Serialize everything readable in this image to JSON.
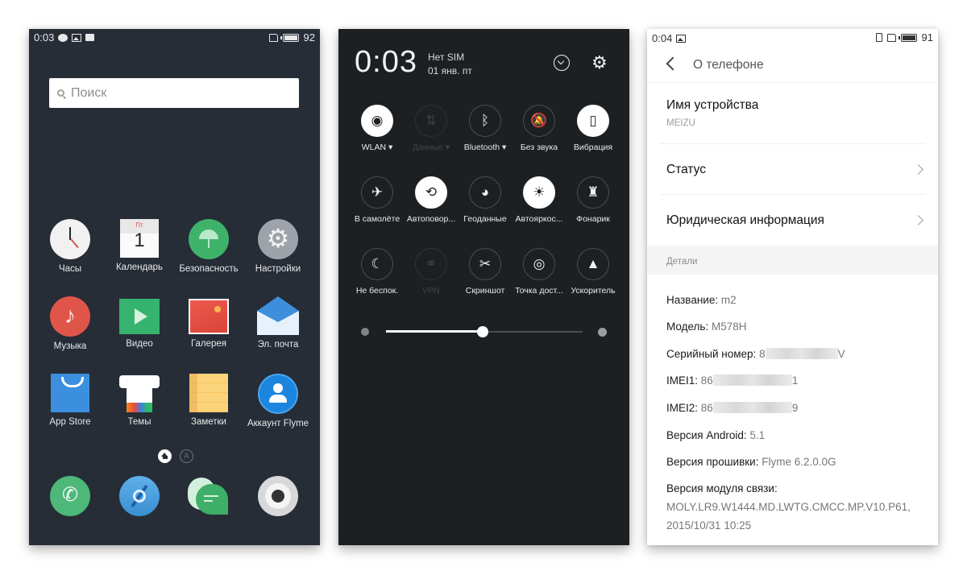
{
  "home_screen": {
    "status_bar": {
      "time": "0:03",
      "battery": "92",
      "left_icons": [
        "message-icon",
        "image-icon",
        "notification-card-icon"
      ],
      "right_icons": [
        "sim-icon",
        "battery-icon"
      ]
    },
    "search": {
      "placeholder": "Поиск"
    },
    "apps": [
      {
        "label": "Часы",
        "icon": "clock-icon"
      },
      {
        "label": "Календарь",
        "icon": "calendar-icon",
        "calendar_day": "Пт",
        "calendar_date": "1"
      },
      {
        "label": "Безопасность",
        "icon": "security-icon"
      },
      {
        "label": "Настройки",
        "icon": "settings-icon"
      },
      {
        "label": "Музыка",
        "icon": "music-icon"
      },
      {
        "label": "Видео",
        "icon": "video-icon"
      },
      {
        "label": "Галерея",
        "icon": "gallery-icon"
      },
      {
        "label": "Эл. почта",
        "icon": "email-icon"
      },
      {
        "label": "App Store",
        "icon": "app-store-icon"
      },
      {
        "label": "Темы",
        "icon": "themes-icon"
      },
      {
        "label": "Заметки",
        "icon": "notes-icon"
      },
      {
        "label": "Аккаунт Flyme",
        "icon": "flyme-account-icon"
      }
    ],
    "page_indicator": {
      "home": "home-icon",
      "app_page_letter": "A"
    },
    "dock": [
      {
        "icon": "phone-icon"
      },
      {
        "icon": "browser-icon"
      },
      {
        "icon": "messages-icon"
      },
      {
        "icon": "camera-icon"
      }
    ],
    "colors": {
      "background": "#262d37"
    }
  },
  "quick_settings": {
    "time": "0:03",
    "sim_status": "Нет SIM",
    "date": "01 янв. пт",
    "tiles": [
      {
        "label": "WLAN ▾",
        "icon": "wifi-icon",
        "state": "on"
      },
      {
        "label": "Данные ▾",
        "icon": "mobile-data-icon",
        "state": "disabled"
      },
      {
        "label": "Bluetooth ▾",
        "icon": "bluetooth-icon",
        "state": "off"
      },
      {
        "label": "Без звука",
        "icon": "mute-icon",
        "state": "off"
      },
      {
        "label": "Вибрация",
        "icon": "vibration-icon",
        "state": "on"
      },
      {
        "label": "В самолёте",
        "icon": "airplane-icon",
        "state": "off"
      },
      {
        "label": "Автоповор...",
        "icon": "auto-rotate-icon",
        "state": "on"
      },
      {
        "label": "Геоданные",
        "icon": "location-icon",
        "state": "off"
      },
      {
        "label": "Автояркос...",
        "icon": "auto-brightness-icon",
        "state": "on"
      },
      {
        "label": "Фонарик",
        "icon": "flashlight-icon",
        "state": "off"
      },
      {
        "label": "Не беспок.",
        "icon": "do-not-disturb-icon",
        "state": "off"
      },
      {
        "label": "VPN",
        "icon": "vpn-icon",
        "state": "disabled"
      },
      {
        "label": "Скриншот",
        "icon": "screenshot-icon",
        "state": "off"
      },
      {
        "label": "Точка дост...",
        "icon": "hotspot-icon",
        "state": "off"
      },
      {
        "label": "Ускоритель",
        "icon": "booster-icon",
        "state": "off"
      }
    ],
    "brightness": 0.49,
    "colors": {
      "background": "#1d2022"
    }
  },
  "about_phone": {
    "status_bar": {
      "time": "0:04",
      "battery": "91"
    },
    "title": "О телефоне",
    "device_name_label": "Имя устройства",
    "device_name_value": "MEIZU",
    "status_label": "Статус",
    "legal_label": "Юридическая информация",
    "section_label": "Детали",
    "details": [
      {
        "key": "Название:",
        "value": "m2"
      },
      {
        "key": "Модель:",
        "value": "M578H"
      },
      {
        "key": "Серийный номер:",
        "value_prefix": "8",
        "value_suffix": "V"
      },
      {
        "key": "IMEI1:",
        "value_prefix": "86",
        "value_suffix": "1"
      },
      {
        "key": "IMEI2:",
        "value_prefix": "86",
        "value_suffix": "9"
      },
      {
        "key": "Версия Android:",
        "value": "5.1"
      },
      {
        "key": "Версия прошивки:",
        "value": "Flyme 6.2.0.0G"
      }
    ],
    "modem": {
      "key": "Версия модуля связи:",
      "line1": "MOLY.LR9.W1444.MD.LWTG.CMCC.MP.V10.P61,",
      "line2": "2015/10/31 10:25"
    }
  }
}
